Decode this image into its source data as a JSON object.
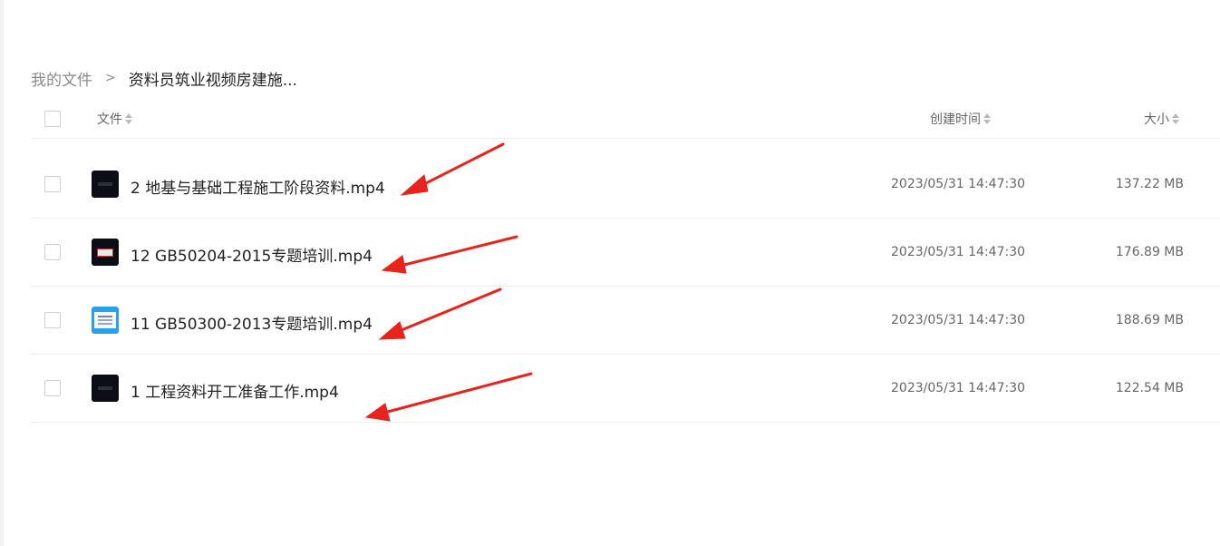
{
  "breadcrumb": {
    "root": "我的文件",
    "separator": ">",
    "current": "资料员筑业视频房建施..."
  },
  "table": {
    "columns": {
      "name": "文件",
      "created": "创建时间",
      "size": "大小"
    },
    "rows": [
      {
        "name": "2 地基与基础工程施工阶段资料.mp4",
        "created": "2023/05/31 14:47:30",
        "size": "137.22 MB",
        "thumb": "dark"
      },
      {
        "name": "12 GB50204-2015专题培训.mp4",
        "created": "2023/05/31 14:47:30",
        "size": "176.89 MB",
        "thumb": "red-dark"
      },
      {
        "name": "11 GB50300-2013专题培训.mp4",
        "created": "2023/05/31 14:47:30",
        "size": "188.69 MB",
        "thumb": "blue"
      },
      {
        "name": "1 工程资料开工准备工作.mp4",
        "created": "2023/05/31 14:47:30",
        "size": "122.54 MB",
        "thumb": "dark"
      }
    ]
  },
  "colors": {
    "annotation_arrow": "#e8231c",
    "divider": "#eceef1"
  }
}
